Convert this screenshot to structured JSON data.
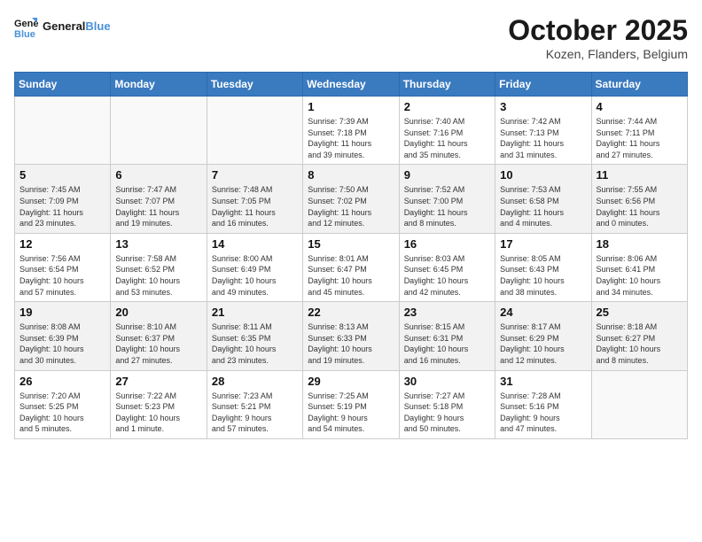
{
  "header": {
    "logo_line1": "General",
    "logo_line2": "Blue",
    "month": "October 2025",
    "location": "Kozen, Flanders, Belgium"
  },
  "weekdays": [
    "Sunday",
    "Monday",
    "Tuesday",
    "Wednesday",
    "Thursday",
    "Friday",
    "Saturday"
  ],
  "weeks": [
    [
      {
        "day": "",
        "info": ""
      },
      {
        "day": "",
        "info": ""
      },
      {
        "day": "",
        "info": ""
      },
      {
        "day": "1",
        "info": "Sunrise: 7:39 AM\nSunset: 7:18 PM\nDaylight: 11 hours\nand 39 minutes."
      },
      {
        "day": "2",
        "info": "Sunrise: 7:40 AM\nSunset: 7:16 PM\nDaylight: 11 hours\nand 35 minutes."
      },
      {
        "day": "3",
        "info": "Sunrise: 7:42 AM\nSunset: 7:13 PM\nDaylight: 11 hours\nand 31 minutes."
      },
      {
        "day": "4",
        "info": "Sunrise: 7:44 AM\nSunset: 7:11 PM\nDaylight: 11 hours\nand 27 minutes."
      }
    ],
    [
      {
        "day": "5",
        "info": "Sunrise: 7:45 AM\nSunset: 7:09 PM\nDaylight: 11 hours\nand 23 minutes."
      },
      {
        "day": "6",
        "info": "Sunrise: 7:47 AM\nSunset: 7:07 PM\nDaylight: 11 hours\nand 19 minutes."
      },
      {
        "day": "7",
        "info": "Sunrise: 7:48 AM\nSunset: 7:05 PM\nDaylight: 11 hours\nand 16 minutes."
      },
      {
        "day": "8",
        "info": "Sunrise: 7:50 AM\nSunset: 7:02 PM\nDaylight: 11 hours\nand 12 minutes."
      },
      {
        "day": "9",
        "info": "Sunrise: 7:52 AM\nSunset: 7:00 PM\nDaylight: 11 hours\nand 8 minutes."
      },
      {
        "day": "10",
        "info": "Sunrise: 7:53 AM\nSunset: 6:58 PM\nDaylight: 11 hours\nand 4 minutes."
      },
      {
        "day": "11",
        "info": "Sunrise: 7:55 AM\nSunset: 6:56 PM\nDaylight: 11 hours\nand 0 minutes."
      }
    ],
    [
      {
        "day": "12",
        "info": "Sunrise: 7:56 AM\nSunset: 6:54 PM\nDaylight: 10 hours\nand 57 minutes."
      },
      {
        "day": "13",
        "info": "Sunrise: 7:58 AM\nSunset: 6:52 PM\nDaylight: 10 hours\nand 53 minutes."
      },
      {
        "day": "14",
        "info": "Sunrise: 8:00 AM\nSunset: 6:49 PM\nDaylight: 10 hours\nand 49 minutes."
      },
      {
        "day": "15",
        "info": "Sunrise: 8:01 AM\nSunset: 6:47 PM\nDaylight: 10 hours\nand 45 minutes."
      },
      {
        "day": "16",
        "info": "Sunrise: 8:03 AM\nSunset: 6:45 PM\nDaylight: 10 hours\nand 42 minutes."
      },
      {
        "day": "17",
        "info": "Sunrise: 8:05 AM\nSunset: 6:43 PM\nDaylight: 10 hours\nand 38 minutes."
      },
      {
        "day": "18",
        "info": "Sunrise: 8:06 AM\nSunset: 6:41 PM\nDaylight: 10 hours\nand 34 minutes."
      }
    ],
    [
      {
        "day": "19",
        "info": "Sunrise: 8:08 AM\nSunset: 6:39 PM\nDaylight: 10 hours\nand 30 minutes."
      },
      {
        "day": "20",
        "info": "Sunrise: 8:10 AM\nSunset: 6:37 PM\nDaylight: 10 hours\nand 27 minutes."
      },
      {
        "day": "21",
        "info": "Sunrise: 8:11 AM\nSunset: 6:35 PM\nDaylight: 10 hours\nand 23 minutes."
      },
      {
        "day": "22",
        "info": "Sunrise: 8:13 AM\nSunset: 6:33 PM\nDaylight: 10 hours\nand 19 minutes."
      },
      {
        "day": "23",
        "info": "Sunrise: 8:15 AM\nSunset: 6:31 PM\nDaylight: 10 hours\nand 16 minutes."
      },
      {
        "day": "24",
        "info": "Sunrise: 8:17 AM\nSunset: 6:29 PM\nDaylight: 10 hours\nand 12 minutes."
      },
      {
        "day": "25",
        "info": "Sunrise: 8:18 AM\nSunset: 6:27 PM\nDaylight: 10 hours\nand 8 minutes."
      }
    ],
    [
      {
        "day": "26",
        "info": "Sunrise: 7:20 AM\nSunset: 5:25 PM\nDaylight: 10 hours\nand 5 minutes."
      },
      {
        "day": "27",
        "info": "Sunrise: 7:22 AM\nSunset: 5:23 PM\nDaylight: 10 hours\nand 1 minute."
      },
      {
        "day": "28",
        "info": "Sunrise: 7:23 AM\nSunset: 5:21 PM\nDaylight: 9 hours\nand 57 minutes."
      },
      {
        "day": "29",
        "info": "Sunrise: 7:25 AM\nSunset: 5:19 PM\nDaylight: 9 hours\nand 54 minutes."
      },
      {
        "day": "30",
        "info": "Sunrise: 7:27 AM\nSunset: 5:18 PM\nDaylight: 9 hours\nand 50 minutes."
      },
      {
        "day": "31",
        "info": "Sunrise: 7:28 AM\nSunset: 5:16 PM\nDaylight: 9 hours\nand 47 minutes."
      },
      {
        "day": "",
        "info": ""
      }
    ]
  ]
}
